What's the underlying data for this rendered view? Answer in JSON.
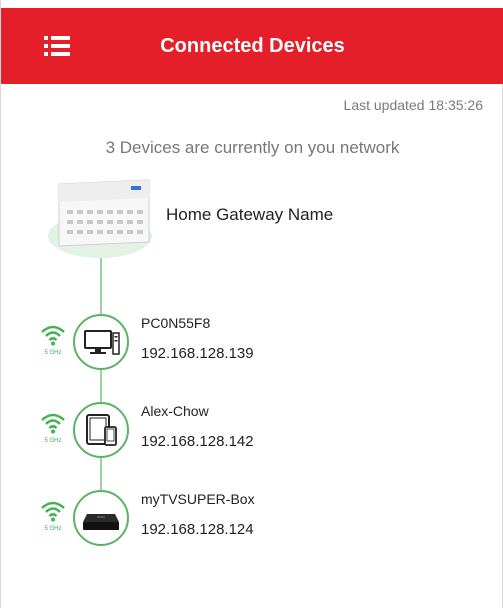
{
  "header": {
    "title": "Connected Devices",
    "menu_icon": "list-menu-icon",
    "color": "#e51f2a"
  },
  "status": {
    "last_updated_label": "Last updated",
    "last_updated_time": "18:35:26",
    "summary": "3 Devices are currently on you network"
  },
  "gateway": {
    "name": "Home Gateway Name",
    "icon": "router-icon"
  },
  "devices": [
    {
      "name": "PC0N55F8",
      "ip": "192.168.128.139",
      "icon": "desktop-computer-icon",
      "band": "5 GHz"
    },
    {
      "name": "Alex-Chow",
      "ip": "192.168.128.142",
      "icon": "tablet-phone-icon",
      "band": "5 GHz"
    },
    {
      "name": "myTVSUPER-Box",
      "ip": "192.168.128.124",
      "icon": "tv-box-icon",
      "band": "5 GHz"
    }
  ],
  "colors": {
    "accent": "#e51f2a",
    "connection": "#5ab463",
    "line": "#9bd29f"
  }
}
